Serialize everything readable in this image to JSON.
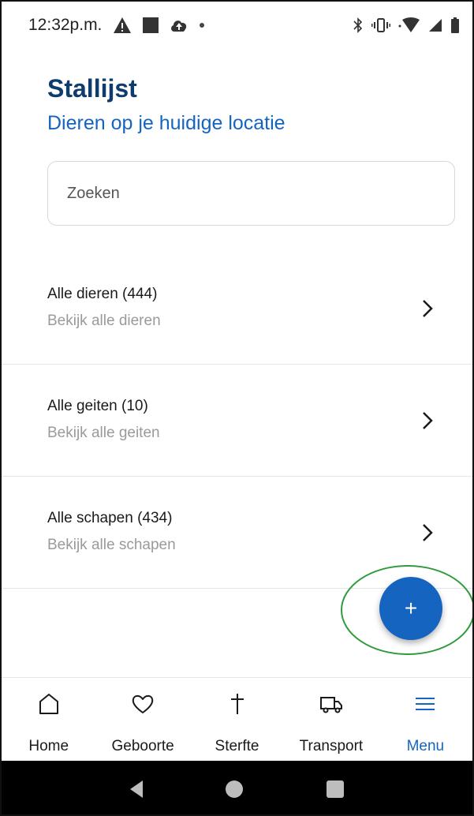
{
  "status_bar": {
    "time": "12:32p.m.",
    "left_icons": [
      "warning-icon",
      "square-notification-icon",
      "cloud-upload-icon",
      "dot-icon"
    ],
    "right_icons": [
      "bluetooth-icon",
      "vibrate-icon",
      "wifi-icon",
      "signal-icon",
      "battery-icon"
    ]
  },
  "header": {
    "title": "Stallijst",
    "subtitle": "Dieren op je huidige locatie"
  },
  "search": {
    "placeholder": "Zoeken",
    "value": ""
  },
  "list": {
    "items": [
      {
        "title": "Alle dieren (444)",
        "subtitle": "Bekijk alle dieren"
      },
      {
        "title": "Alle geiten (10)",
        "subtitle": "Bekijk alle geiten"
      },
      {
        "title": "Alle schapen (434)",
        "subtitle": "Bekijk alle schapen"
      }
    ]
  },
  "fab": {
    "label": "+",
    "color": "#1565c0",
    "highlight_color": "#2e9b3c"
  },
  "bottom_nav": {
    "items": [
      {
        "label": "Home",
        "icon": "home-icon"
      },
      {
        "label": "Geboorte",
        "icon": "heart-icon"
      },
      {
        "label": "Sterfte",
        "icon": "cross-icon"
      },
      {
        "label": "Transport",
        "icon": "truck-icon"
      },
      {
        "label": "Menu",
        "icon": "menu-icon",
        "active": true
      }
    ]
  },
  "colors": {
    "title": "#0f3c6e",
    "accent": "#1565c0",
    "muted_text": "#9a9a9a"
  }
}
